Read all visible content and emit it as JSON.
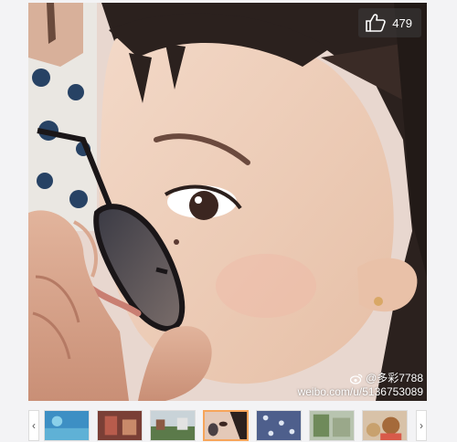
{
  "like": {
    "icon": "thumbs-up-icon",
    "count": "479"
  },
  "watermark": {
    "icon": "weibo-icon",
    "user": "@多彩7788",
    "url": "weibo.com/u/5136753089"
  },
  "thumbnails": {
    "prev_icon": "chevron-left-icon",
    "next_icon": "chevron-right-icon",
    "prev_label": "‹",
    "next_label": "›",
    "active_index": 3,
    "count": 7
  },
  "colors": {
    "active_border": "#f7a55a",
    "background": "#f3f3f5"
  }
}
